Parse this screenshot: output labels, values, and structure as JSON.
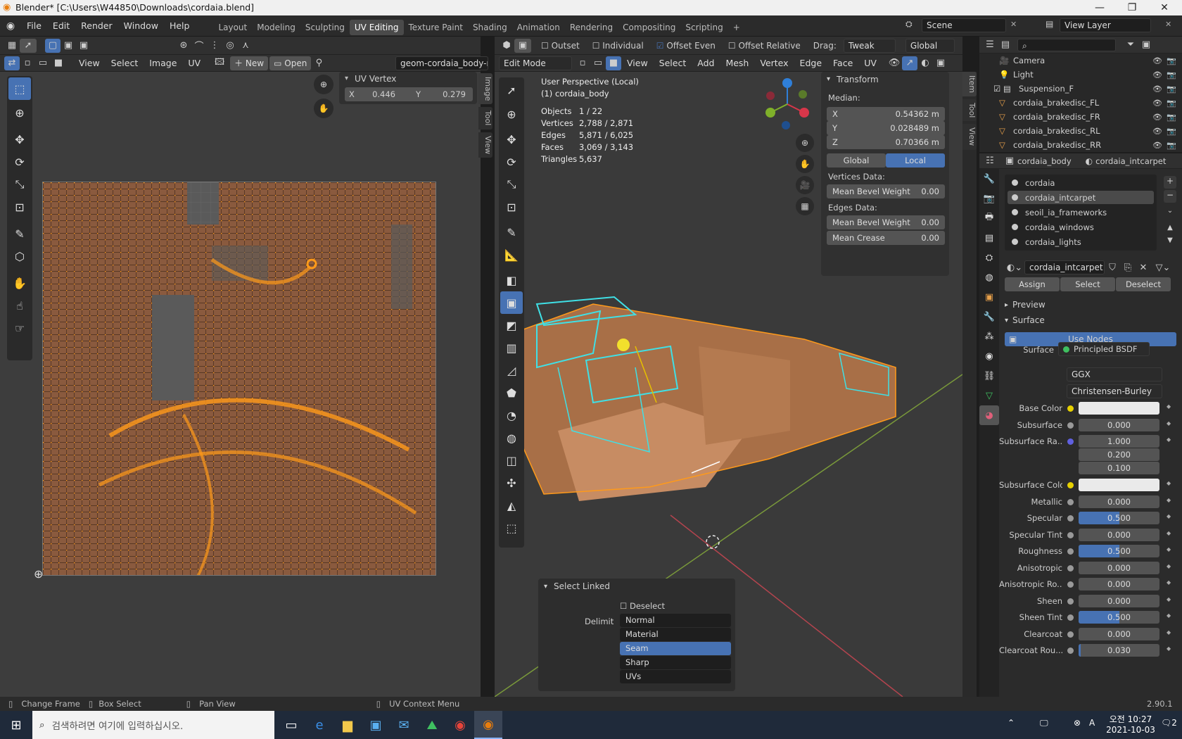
{
  "window": {
    "title": "Blender* [C:\\Users\\W44850\\Downloads\\cordaia.blend]",
    "minimize": "—",
    "maximize": "❐",
    "close": "✕"
  },
  "topbar": {
    "menus": [
      "File",
      "Edit",
      "Render",
      "Window",
      "Help"
    ],
    "workspaces": [
      "Layout",
      "Modeling",
      "Sculpting",
      "UV Editing",
      "Texture Paint",
      "Shading",
      "Animation",
      "Rendering",
      "Compositing",
      "Scripting"
    ],
    "active_workspace": "UV Editing",
    "add_tab": "+",
    "scene": "Scene",
    "view_layer": "View Layer"
  },
  "uv_editor": {
    "menus": [
      "View",
      "Select",
      "Image",
      "UV"
    ],
    "new_label": "New",
    "open_label": "Open",
    "image_name": "geom-cordaia_body-m...",
    "uv_vertex_panel": {
      "title": "UV Vertex",
      "x_label": "X",
      "x_value": "0.446",
      "y_label": "Y",
      "y_value": "0.279"
    },
    "side_tabs": [
      "Image",
      "Tool",
      "View"
    ]
  },
  "viewport": {
    "header": {
      "opt_outset": "Outset",
      "opt_individual": "Individual",
      "opt_offset_even": "Offset Even",
      "opt_offset_relative": "Offset Relative",
      "drag_label": "Drag:",
      "drag_value": "Tweak",
      "orientation": "Global"
    },
    "header2": {
      "mode": "Edit Mode",
      "menus": [
        "View",
        "Select",
        "Add",
        "Mesh",
        "Vertex",
        "Edge",
        "Face",
        "UV"
      ]
    },
    "overlay_info": {
      "perspective": "User Perspective (Local)",
      "object": "(1) cordaia_body",
      "stats": [
        {
          "label": "Objects",
          "value": "1 / 22"
        },
        {
          "label": "Vertices",
          "value": "2,788 / 2,871"
        },
        {
          "label": "Edges",
          "value": "5,871 / 6,025"
        },
        {
          "label": "Faces",
          "value": "3,069 / 3,143"
        },
        {
          "label": "Triangles",
          "value": "5,637"
        }
      ]
    },
    "transform": {
      "title": "Transform",
      "median_label": "Median:",
      "x_label": "X",
      "x_value": "0.54362 m",
      "y_label": "Y",
      "y_value": "0.028489 m",
      "z_label": "Z",
      "z_value": "0.70366 m",
      "global_btn": "Global",
      "local_btn": "Local",
      "vertices_data": "Vertices Data:",
      "mean_bevel_v": "Mean Bevel Weight",
      "mean_bevel_v_val": "0.00",
      "edges_data": "Edges Data:",
      "mean_bevel_e": "Mean Bevel Weight",
      "mean_bevel_e_val": "0.00",
      "mean_crease": "Mean Crease",
      "mean_crease_val": "0.00"
    },
    "side_tabs": [
      "Item",
      "Tool",
      "View"
    ],
    "select_linked": {
      "title": "Select Linked",
      "deselect": "Deselect",
      "delimit_label": "Delimit",
      "options": [
        "Normal",
        "Material",
        "Seam",
        "Sharp",
        "UVs"
      ],
      "selected": "Seam"
    }
  },
  "outliner": {
    "items": [
      {
        "name": "Camera",
        "icon": "camera-icon",
        "color": "#e8a04a"
      },
      {
        "name": "Light",
        "icon": "light-icon",
        "color": "#e8a04a"
      },
      {
        "name": "Suspension_F",
        "icon": "collection-icon",
        "color": "#dddddd"
      },
      {
        "name": "cordaia_brakedisc_FL",
        "icon": "mesh-icon",
        "color": "#e8a04a"
      },
      {
        "name": "cordaia_brakedisc_FR",
        "icon": "mesh-icon",
        "color": "#e8a04a"
      },
      {
        "name": "cordaia_brakedisc_RL",
        "icon": "mesh-icon",
        "color": "#e8a04a"
      },
      {
        "name": "cordaia_brakedisc_RR",
        "icon": "mesh-icon",
        "color": "#e8a04a"
      }
    ]
  },
  "properties": {
    "object_name": "cordaia_body",
    "material_name": "cordaia_intcarpet",
    "slots": [
      "cordaia",
      "cordaia_intcarpet",
      "seoil_ia_frameworks",
      "cordaia_windows",
      "cordaia_lights"
    ],
    "active_slot": "cordaia_intcarpet",
    "material_field": "cordaia_intcarpet",
    "assign": "Assign",
    "select": "Select",
    "deselect": "Deselect",
    "preview": "Preview",
    "surface": "Surface",
    "use_nodes": "Use Nodes",
    "surface_label": "Surface",
    "surface_value": "Principled BSDF",
    "distribution": "GGX",
    "subsurface_method": "Christensen-Burley",
    "params": [
      {
        "label": "Base Color",
        "type": "color",
        "value": ""
      },
      {
        "label": "Subsurface",
        "type": "num",
        "value": "0.000",
        "fill": 0
      },
      {
        "label": "Subsurface Ra...",
        "type": "vec",
        "value": "1.000",
        "v2": "0.200",
        "v3": "0.100"
      },
      {
        "label": "Subsurface Colo",
        "type": "color",
        "value": ""
      },
      {
        "label": "Metallic",
        "type": "num",
        "value": "0.000",
        "fill": 0
      },
      {
        "label": "Specular",
        "type": "num",
        "value": "0.500",
        "fill": 0.5
      },
      {
        "label": "Specular Tint",
        "type": "num",
        "value": "0.000",
        "fill": 0
      },
      {
        "label": "Roughness",
        "type": "num",
        "value": "0.500",
        "fill": 0.5
      },
      {
        "label": "Anisotropic",
        "type": "num",
        "value": "0.000",
        "fill": 0
      },
      {
        "label": "Anisotropic Ro...",
        "type": "num",
        "value": "0.000",
        "fill": 0
      },
      {
        "label": "Sheen",
        "type": "num",
        "value": "0.000",
        "fill": 0
      },
      {
        "label": "Sheen Tint",
        "type": "num",
        "value": "0.500",
        "fill": 0.5
      },
      {
        "label": "Clearcoat",
        "type": "num",
        "value": "0.000",
        "fill": 0
      },
      {
        "label": "Clearcoat Rou...",
        "type": "num",
        "value": "0.030",
        "fill": 0.03
      }
    ]
  },
  "statusbar": {
    "items": [
      "Change Frame",
      "Box Select",
      "Pan View",
      "UV Context Menu"
    ],
    "version": "2.90.1"
  },
  "taskbar": {
    "search_placeholder": "검색하려면 여기에 입력하십시오.",
    "time": "오전 10:27",
    "date": "2021-10-03",
    "notif": "2"
  }
}
